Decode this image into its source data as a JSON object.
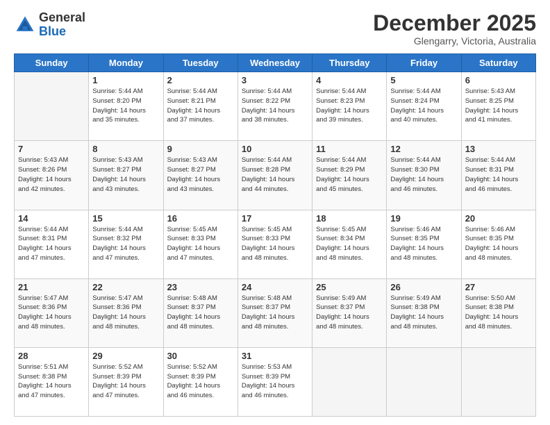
{
  "header": {
    "logo_general": "General",
    "logo_blue": "Blue",
    "month_title": "December 2025",
    "location": "Glengarry, Victoria, Australia"
  },
  "weekdays": [
    "Sunday",
    "Monday",
    "Tuesday",
    "Wednesday",
    "Thursday",
    "Friday",
    "Saturday"
  ],
  "weeks": [
    [
      {
        "day": "",
        "info": ""
      },
      {
        "day": "1",
        "info": "Sunrise: 5:44 AM\nSunset: 8:20 PM\nDaylight: 14 hours\nand 35 minutes."
      },
      {
        "day": "2",
        "info": "Sunrise: 5:44 AM\nSunset: 8:21 PM\nDaylight: 14 hours\nand 37 minutes."
      },
      {
        "day": "3",
        "info": "Sunrise: 5:44 AM\nSunset: 8:22 PM\nDaylight: 14 hours\nand 38 minutes."
      },
      {
        "day": "4",
        "info": "Sunrise: 5:44 AM\nSunset: 8:23 PM\nDaylight: 14 hours\nand 39 minutes."
      },
      {
        "day": "5",
        "info": "Sunrise: 5:44 AM\nSunset: 8:24 PM\nDaylight: 14 hours\nand 40 minutes."
      },
      {
        "day": "6",
        "info": "Sunrise: 5:43 AM\nSunset: 8:25 PM\nDaylight: 14 hours\nand 41 minutes."
      }
    ],
    [
      {
        "day": "7",
        "info": "Sunrise: 5:43 AM\nSunset: 8:26 PM\nDaylight: 14 hours\nand 42 minutes."
      },
      {
        "day": "8",
        "info": "Sunrise: 5:43 AM\nSunset: 8:27 PM\nDaylight: 14 hours\nand 43 minutes."
      },
      {
        "day": "9",
        "info": "Sunrise: 5:43 AM\nSunset: 8:27 PM\nDaylight: 14 hours\nand 43 minutes."
      },
      {
        "day": "10",
        "info": "Sunrise: 5:44 AM\nSunset: 8:28 PM\nDaylight: 14 hours\nand 44 minutes."
      },
      {
        "day": "11",
        "info": "Sunrise: 5:44 AM\nSunset: 8:29 PM\nDaylight: 14 hours\nand 45 minutes."
      },
      {
        "day": "12",
        "info": "Sunrise: 5:44 AM\nSunset: 8:30 PM\nDaylight: 14 hours\nand 46 minutes."
      },
      {
        "day": "13",
        "info": "Sunrise: 5:44 AM\nSunset: 8:31 PM\nDaylight: 14 hours\nand 46 minutes."
      }
    ],
    [
      {
        "day": "14",
        "info": "Sunrise: 5:44 AM\nSunset: 8:31 PM\nDaylight: 14 hours\nand 47 minutes."
      },
      {
        "day": "15",
        "info": "Sunrise: 5:44 AM\nSunset: 8:32 PM\nDaylight: 14 hours\nand 47 minutes."
      },
      {
        "day": "16",
        "info": "Sunrise: 5:45 AM\nSunset: 8:33 PM\nDaylight: 14 hours\nand 47 minutes."
      },
      {
        "day": "17",
        "info": "Sunrise: 5:45 AM\nSunset: 8:33 PM\nDaylight: 14 hours\nand 48 minutes."
      },
      {
        "day": "18",
        "info": "Sunrise: 5:45 AM\nSunset: 8:34 PM\nDaylight: 14 hours\nand 48 minutes."
      },
      {
        "day": "19",
        "info": "Sunrise: 5:46 AM\nSunset: 8:35 PM\nDaylight: 14 hours\nand 48 minutes."
      },
      {
        "day": "20",
        "info": "Sunrise: 5:46 AM\nSunset: 8:35 PM\nDaylight: 14 hours\nand 48 minutes."
      }
    ],
    [
      {
        "day": "21",
        "info": "Sunrise: 5:47 AM\nSunset: 8:36 PM\nDaylight: 14 hours\nand 48 minutes."
      },
      {
        "day": "22",
        "info": "Sunrise: 5:47 AM\nSunset: 8:36 PM\nDaylight: 14 hours\nand 48 minutes."
      },
      {
        "day": "23",
        "info": "Sunrise: 5:48 AM\nSunset: 8:37 PM\nDaylight: 14 hours\nand 48 minutes."
      },
      {
        "day": "24",
        "info": "Sunrise: 5:48 AM\nSunset: 8:37 PM\nDaylight: 14 hours\nand 48 minutes."
      },
      {
        "day": "25",
        "info": "Sunrise: 5:49 AM\nSunset: 8:37 PM\nDaylight: 14 hours\nand 48 minutes."
      },
      {
        "day": "26",
        "info": "Sunrise: 5:49 AM\nSunset: 8:38 PM\nDaylight: 14 hours\nand 48 minutes."
      },
      {
        "day": "27",
        "info": "Sunrise: 5:50 AM\nSunset: 8:38 PM\nDaylight: 14 hours\nand 48 minutes."
      }
    ],
    [
      {
        "day": "28",
        "info": "Sunrise: 5:51 AM\nSunset: 8:38 PM\nDaylight: 14 hours\nand 47 minutes."
      },
      {
        "day": "29",
        "info": "Sunrise: 5:52 AM\nSunset: 8:39 PM\nDaylight: 14 hours\nand 47 minutes."
      },
      {
        "day": "30",
        "info": "Sunrise: 5:52 AM\nSunset: 8:39 PM\nDaylight: 14 hours\nand 46 minutes."
      },
      {
        "day": "31",
        "info": "Sunrise: 5:53 AM\nSunset: 8:39 PM\nDaylight: 14 hours\nand 46 minutes."
      },
      {
        "day": "",
        "info": ""
      },
      {
        "day": "",
        "info": ""
      },
      {
        "day": "",
        "info": ""
      }
    ]
  ]
}
